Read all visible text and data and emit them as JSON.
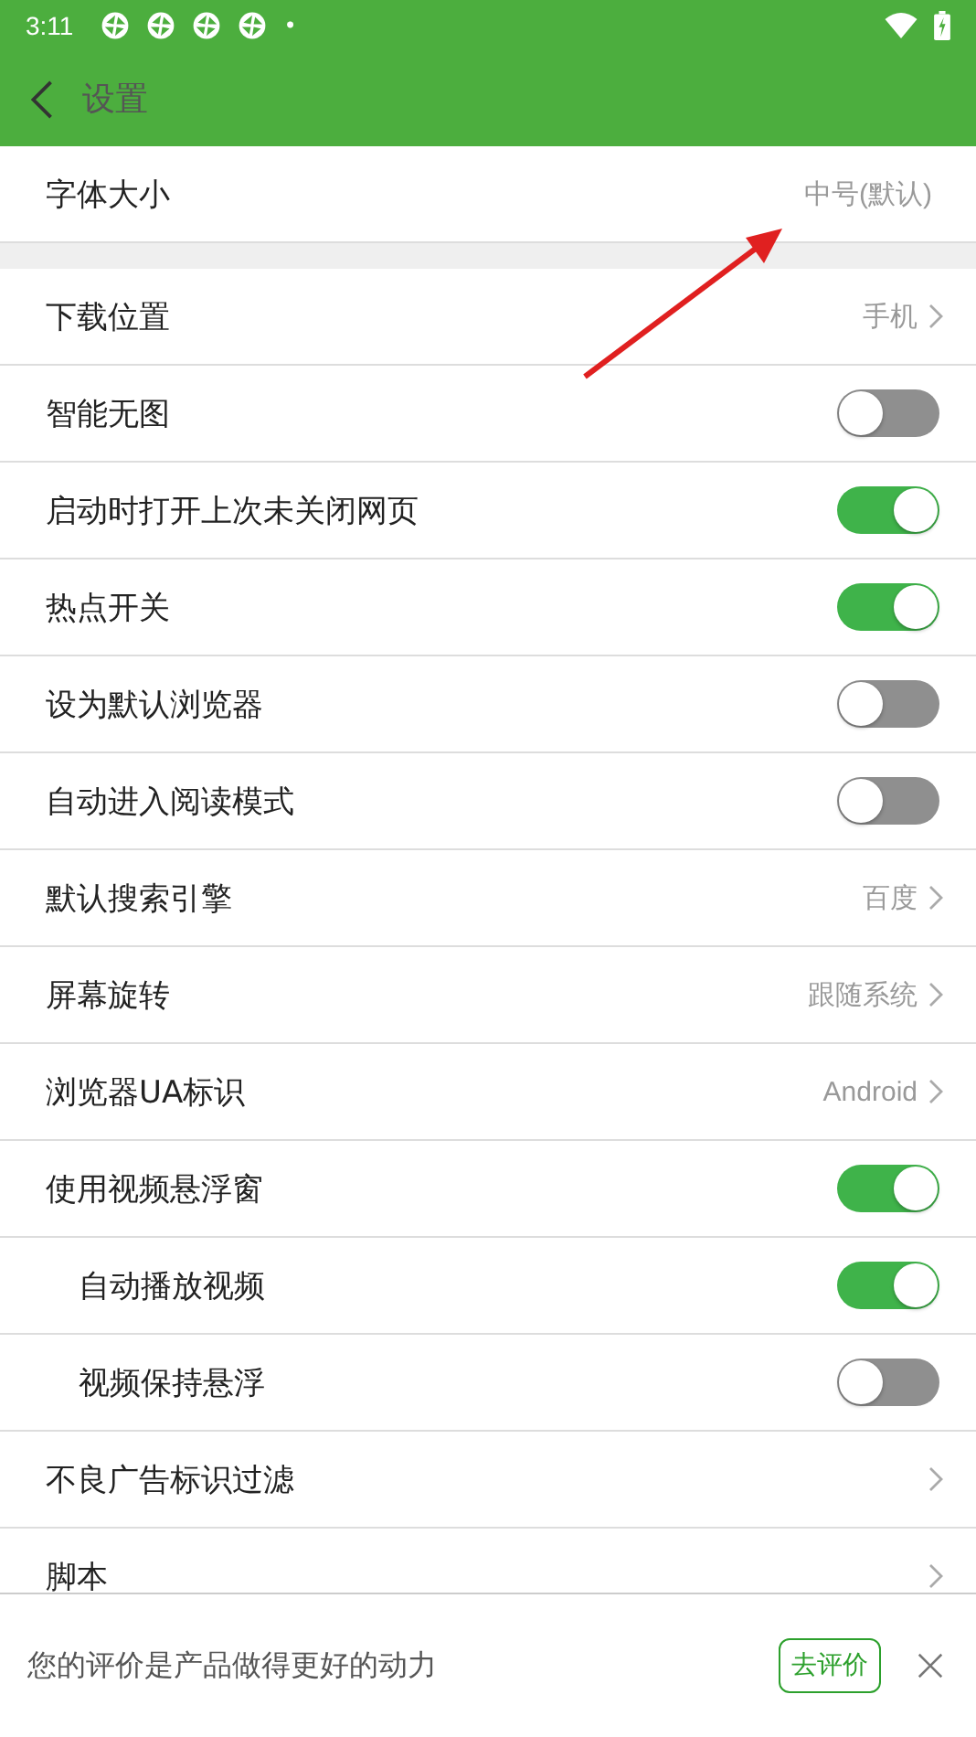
{
  "status_bar": {
    "time": "3:11",
    "dot": "•"
  },
  "toolbar": {
    "title": "设置"
  },
  "groups": [
    {
      "rows": [
        {
          "kind": "value",
          "label": "字体大小",
          "value": "中号(默认)",
          "indented": false
        }
      ]
    },
    {
      "rows": [
        {
          "kind": "link",
          "label": "下载位置",
          "value": "手机",
          "indented": false
        },
        {
          "kind": "toggle",
          "label": "智能无图",
          "on": false,
          "indented": false
        },
        {
          "kind": "toggle",
          "label": "启动时打开上次未关闭网页",
          "on": true,
          "indented": false
        },
        {
          "kind": "toggle",
          "label": "热点开关",
          "on": true,
          "indented": false
        },
        {
          "kind": "toggle",
          "label": "设为默认浏览器",
          "on": false,
          "indented": false
        },
        {
          "kind": "toggle",
          "label": "自动进入阅读模式",
          "on": false,
          "indented": false
        },
        {
          "kind": "link",
          "label": "默认搜索引擎",
          "value": "百度",
          "indented": false
        },
        {
          "kind": "link",
          "label": "屏幕旋转",
          "value": "跟随系统",
          "indented": false
        },
        {
          "kind": "link",
          "label": "浏览器UA标识",
          "value": "Android",
          "indented": false
        },
        {
          "kind": "toggle",
          "label": "使用视频悬浮窗",
          "on": true,
          "indented": false
        },
        {
          "kind": "toggle",
          "label": "自动播放视频",
          "on": true,
          "indented": true
        },
        {
          "kind": "toggle",
          "label": "视频保持悬浮",
          "on": false,
          "indented": true
        },
        {
          "kind": "link",
          "label": "不良广告标识过滤",
          "indented": false
        },
        {
          "kind": "link",
          "label": "脚本",
          "indented": false
        }
      ]
    }
  ],
  "rating_bar": {
    "text": "您的评价是产品做得更好的动力",
    "button": "去评价"
  }
}
